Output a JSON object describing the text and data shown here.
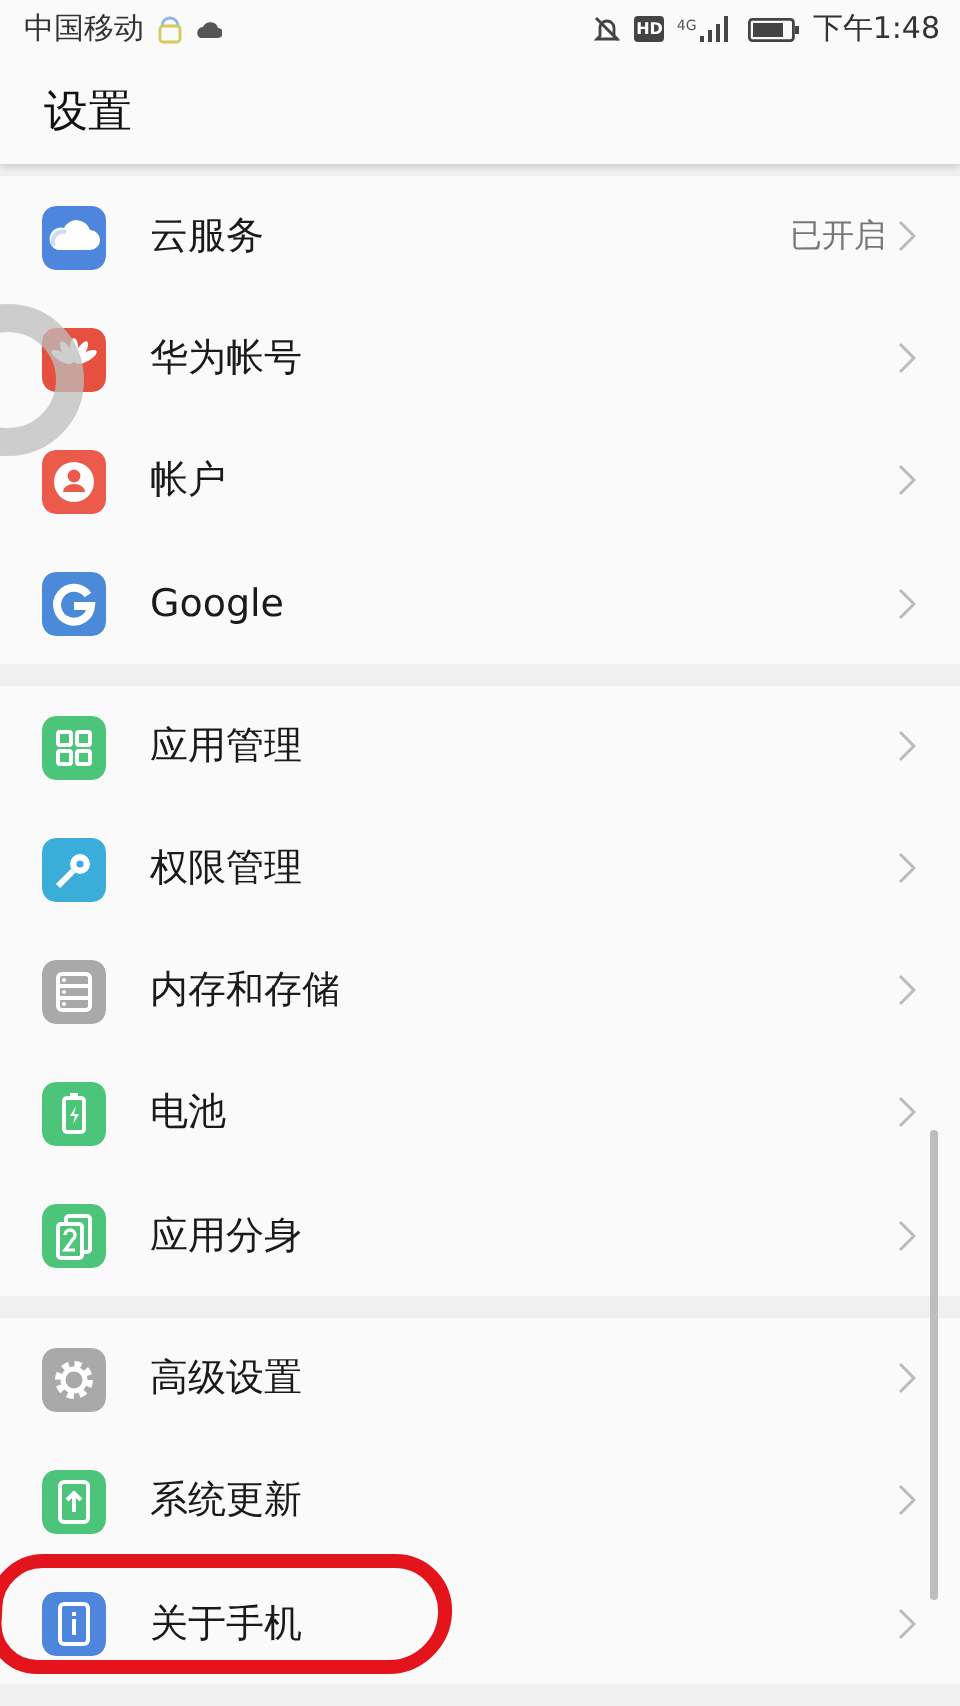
{
  "status_bar": {
    "carrier": "中国移动",
    "hd_badge": "HD",
    "network": "4G",
    "time": "下午1:48"
  },
  "header": {
    "title": "设置"
  },
  "groups": [
    {
      "items": [
        {
          "kind": "cloud",
          "label": "云服务",
          "value": "已开启",
          "highlighted": false
        },
        {
          "kind": "petals",
          "label": "华为帐号",
          "highlighted": false
        },
        {
          "kind": "person",
          "label": "帐户",
          "highlighted": false
        },
        {
          "kind": "g",
          "label": "Google",
          "highlighted": false
        }
      ]
    },
    {
      "items": [
        {
          "kind": "grid",
          "label": "应用管理",
          "highlighted": false
        },
        {
          "kind": "key",
          "label": "权限管理",
          "highlighted": false
        },
        {
          "kind": "storage",
          "label": "内存和存储",
          "highlighted": false
        },
        {
          "kind": "battery",
          "label": "电池",
          "highlighted": false
        },
        {
          "kind": "clone",
          "label": "应用分身",
          "highlighted": false
        }
      ]
    },
    {
      "items": [
        {
          "kind": "gear",
          "label": "高级设置",
          "highlighted": false
        },
        {
          "kind": "update",
          "label": "系统更新",
          "highlighted": false
        },
        {
          "kind": "info",
          "label": "关于手机",
          "highlighted": true
        }
      ]
    }
  ]
}
